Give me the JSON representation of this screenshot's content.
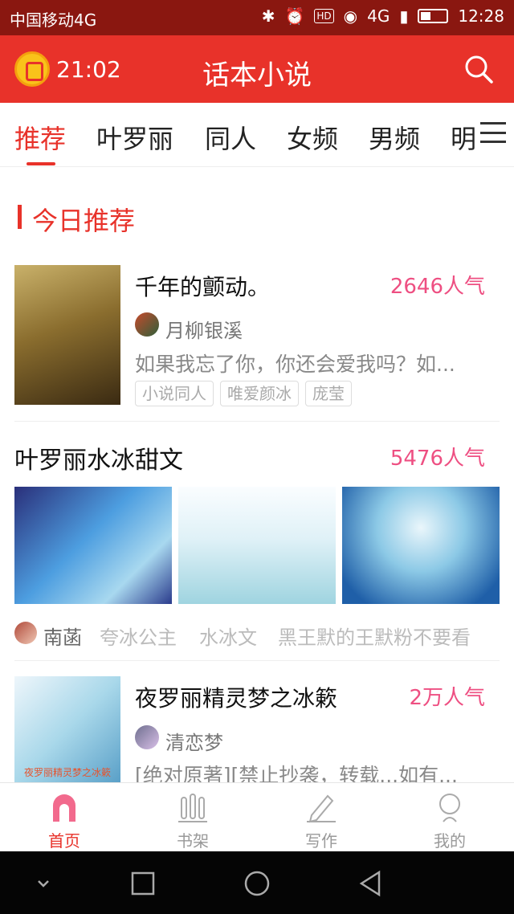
{
  "status_bar": {
    "carrier": "中国移动4G",
    "network": "4G",
    "time": "12:28",
    "hd_badge": "HD"
  },
  "header": {
    "reading_time": "21:02",
    "title": "话本小说",
    "brand_color": "#e8322a"
  },
  "tabs": [
    {
      "label": "推荐",
      "active": true
    },
    {
      "label": "叶罗丽"
    },
    {
      "label": "同人"
    },
    {
      "label": "女频"
    },
    {
      "label": "男频"
    },
    {
      "label": "明"
    }
  ],
  "section": {
    "title": "今日推荐"
  },
  "featured": {
    "title": "千年的颤动。",
    "popularity": "2646人气",
    "author": "月柳银溪",
    "description": "如果我忘了你，你还会爱我吗？如...",
    "tags": [
      "小说同人",
      "唯爱颜冰",
      "庞莹"
    ]
  },
  "collection": {
    "title": "叶罗丽水冰甜文",
    "popularity": "5476人气",
    "author": "南菡",
    "tags": [
      "夸冰公主",
      "水冰文",
      "黑王默的王默粉不要看"
    ]
  },
  "book3": {
    "title": "夜罗丽精灵梦之冰簌",
    "popularity": "2万人气",
    "author": "清恋梦",
    "description": "[绝对原著][禁止抄袭，转载...如有...",
    "cover_caption": "夜罗丽精灵梦之冰簌"
  },
  "bottom_nav": [
    {
      "label": "首页",
      "icon": "home-icon",
      "active": true
    },
    {
      "label": "书架",
      "icon": "bookshelf-icon"
    },
    {
      "label": "写作",
      "icon": "pencil-icon"
    },
    {
      "label": "我的",
      "icon": "profile-icon"
    }
  ],
  "colors": {
    "accent": "#e8322a",
    "popularity": "#ee4f82",
    "status_bar": "#8a1710"
  }
}
